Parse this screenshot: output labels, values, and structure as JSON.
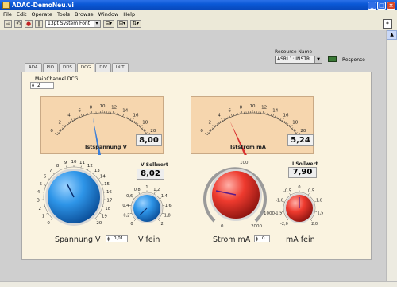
{
  "window": {
    "title": "ADAC-DemoNeu.vi"
  },
  "menu": [
    "File",
    "Edit",
    "Operate",
    "Tools",
    "Browse",
    "Window",
    "Help"
  ],
  "toolbar": {
    "font": "13pt System Font"
  },
  "resource": {
    "label": "Resource Name",
    "value": "ASRL1::INSTR",
    "status_label": "Response",
    "status_color": "#3A7A36"
  },
  "tabs": [
    "ADA",
    "PIO",
    "DDS",
    "DCG",
    "DIV",
    "INIT"
  ],
  "active_tab": "DCG",
  "main_channel": {
    "label": "MainChannel DCG",
    "value": "2"
  },
  "meter_voltage": {
    "label": "Istspannung V",
    "readout": "8,00",
    "scale": [
      "0",
      "2",
      "4",
      "6",
      "8",
      "10",
      "12",
      "14",
      "16",
      "18",
      "20"
    ],
    "value": 8.0,
    "needle_color": "#3A7ED8"
  },
  "meter_current": {
    "label": "Iststrom mA",
    "readout": "5,24",
    "scale": [
      "0",
      "2",
      "4",
      "6",
      "8",
      "10",
      "12",
      "14",
      "16",
      "18",
      "20"
    ],
    "value": 5.24,
    "needle_color": "#D83030"
  },
  "knob_voltage": {
    "label": "Spannung V",
    "scale": [
      "0",
      "1",
      "2",
      "3",
      "4",
      "5",
      "6",
      "7",
      "8",
      "9",
      "10",
      "11",
      "12",
      "13",
      "14",
      "15",
      "16",
      "17",
      "18",
      "19",
      "20"
    ],
    "value": 8.0,
    "color": "#2A8BE0"
  },
  "knob_vfein": {
    "label": "V fein",
    "scale": [
      "0",
      "0,2",
      "0,4",
      "0,6",
      "0,8",
      "1",
      "1,2",
      "1,4",
      "1,6",
      "1,8",
      "2"
    ],
    "value": 0.01,
    "color": "#2A8BE0",
    "value_text": "0,01"
  },
  "voltage_setpoint": {
    "label": "V Sollwert",
    "value": "8,02"
  },
  "knob_current": {
    "label": "Strom mA",
    "scale": [
      "0",
      "100",
      "1000",
      "2000"
    ],
    "value": 7.9,
    "color": "#E03030"
  },
  "knob_mafein": {
    "label": "mA fein",
    "scale": [
      "-2,0",
      "-1,5",
      "-1,0",
      "-0,5",
      "0",
      "0,5",
      "1,0",
      "1,5",
      "2,0"
    ],
    "value": 0,
    "color": "#E03030"
  },
  "current_setpoint": {
    "label": "I Sollwert",
    "value": "7,90"
  },
  "current_fine_value": "0"
}
